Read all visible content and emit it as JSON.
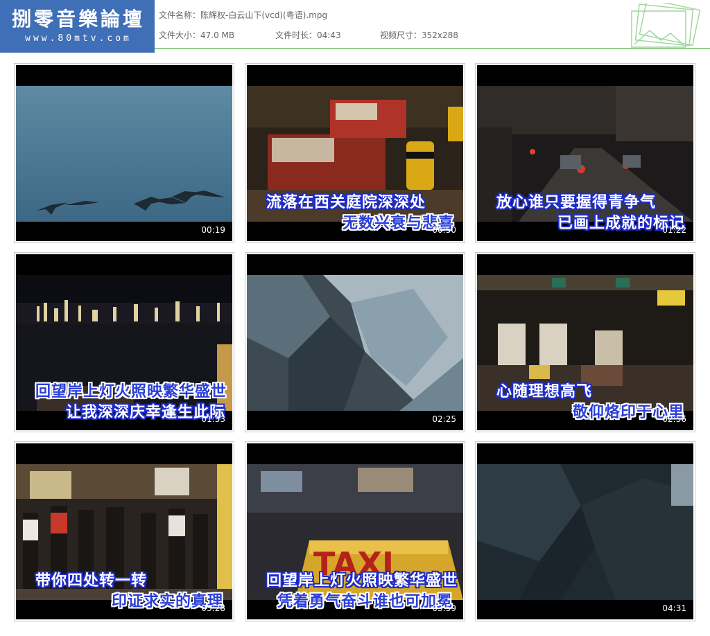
{
  "logo": {
    "title": "捌零音樂論壇",
    "url": "www.80mtv.com"
  },
  "file_info": {
    "name_label": "文件名称：",
    "name_value": "陈辉权-白云山下(vcd)(粤语).mpg",
    "size_label": "文件大小：",
    "size_value": "47.0 MB",
    "duration_label": "文件时长：",
    "duration_value": "04:43",
    "dimensions_label": "视频尺寸：",
    "dimensions_value": "352x288"
  },
  "thumbnails": [
    {
      "time": "00:19",
      "line1": "",
      "line2": "",
      "scene": "sky-birds"
    },
    {
      "time": "00:50",
      "line1": "流落在西关庭院深深处",
      "line2": "无数兴衰与悲喜",
      "scene": "taxis-night"
    },
    {
      "time": "01:22",
      "line1": "放心谁只要握得青争气",
      "line2": "已画上成就的标记",
      "scene": "street-night"
    },
    {
      "time": "01:53",
      "line1": "回望岸上灯火照映繁华盛世",
      "line2": "让我深深庆幸逢生此际",
      "scene": "harbour-skyline"
    },
    {
      "time": "02:25",
      "line1": "",
      "line2": "",
      "scene": "rock-face"
    },
    {
      "time": "02:56",
      "line1": "心随理想高飞",
      "line2": "敬仰烙印于心里",
      "scene": "toll-plaza"
    },
    {
      "time": "03:28",
      "line1": "带你四处转一转",
      "line2": "印证求实的真理",
      "scene": "crowd-street"
    },
    {
      "time": "03:59",
      "line1": "回望岸上灯火照映繁华盛世",
      "line2": "凭着勇气奋斗谁也可加冕",
      "scene": "taxi-sign",
      "sign": "TAXI"
    },
    {
      "time": "04:31",
      "line1": "",
      "line2": "",
      "scene": "dark-rock"
    }
  ],
  "colors": {
    "logo_bg": "#3f6fb7",
    "header_line": "#8ccf8c",
    "subtitle_outline": "#1e2cc8"
  }
}
